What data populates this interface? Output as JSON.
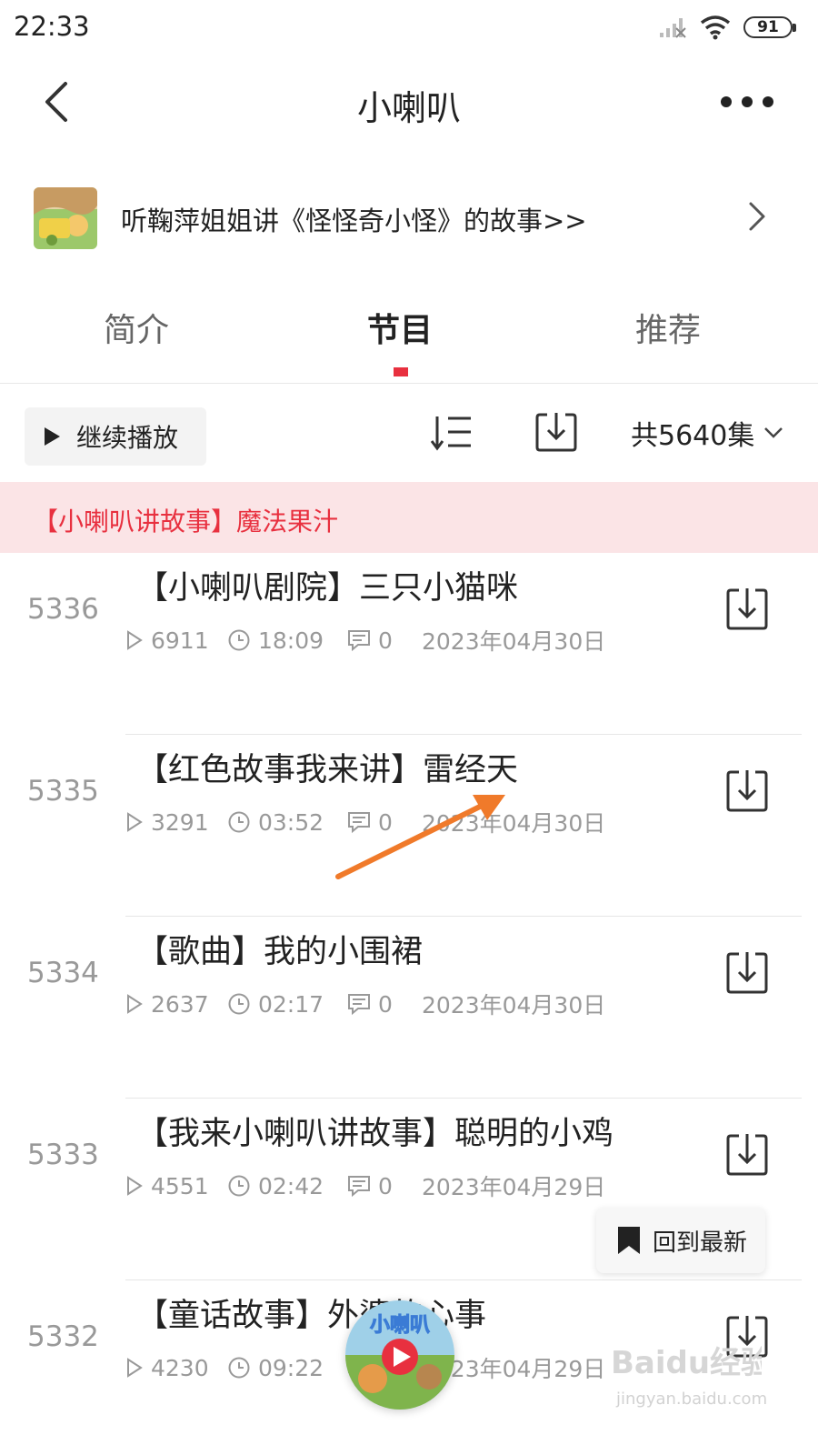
{
  "status": {
    "time": "22:33",
    "battery": "91"
  },
  "header": {
    "title": "小喇叭"
  },
  "promo": {
    "text": "听鞠萍姐姐讲《怪怪奇小怪》的故事>>"
  },
  "tabs": [
    {
      "label": "简介",
      "active": false
    },
    {
      "label": "节目",
      "active": true
    },
    {
      "label": "推荐",
      "active": false
    }
  ],
  "toolbar": {
    "continue_label": "继续播放",
    "episode_count": "共5640集"
  },
  "now_playing": {
    "text": "【小喇叭讲故事】魔法果汁"
  },
  "episodes": [
    {
      "num": "5336",
      "title": "【小喇叭剧院】三只小猫咪",
      "plays": "6911",
      "duration": "18:09",
      "comments": "0",
      "date": "2023年04月30日"
    },
    {
      "num": "5335",
      "title": "【红色故事我来讲】雷经天",
      "plays": "3291",
      "duration": "03:52",
      "comments": "0",
      "date": "2023年04月30日"
    },
    {
      "num": "5334",
      "title": "【歌曲】我的小围裙",
      "plays": "2637",
      "duration": "02:17",
      "comments": "0",
      "date": "2023年04月30日"
    },
    {
      "num": "5333",
      "title": "【我来小喇叭讲故事】聪明的小鸡",
      "plays": "4551",
      "duration": "02:42",
      "comments": "0",
      "date": "2023年04月29日"
    },
    {
      "num": "5332",
      "title": "【童话故事】外婆的心事",
      "plays": "4230",
      "duration": "09:22",
      "comments": "0",
      "date": "2023年04月29日"
    }
  ],
  "floating": {
    "back_to_latest": "回到最新"
  },
  "mini_player": {
    "label": "小喇叭"
  },
  "watermark": {
    "brand": "Baidu经验",
    "url": "jingyan.baidu.com"
  },
  "colors": {
    "accent": "#e8303f",
    "banner_bg": "#fbe4e6",
    "secondary_text": "#999999",
    "arrow": "#f07a2a"
  }
}
